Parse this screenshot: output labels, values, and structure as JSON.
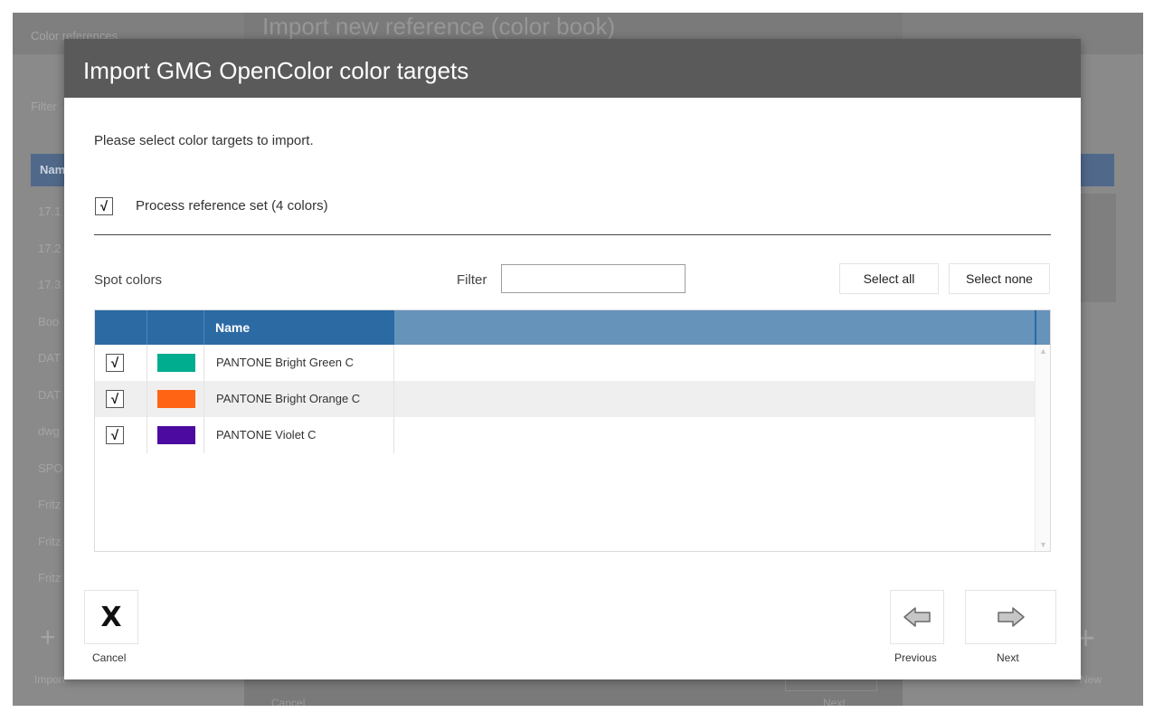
{
  "background": {
    "tab_label": "Color references",
    "filter_label": "Filter",
    "header_label": "Name",
    "rows": [
      "17.1",
      "17.2",
      "17.3",
      "Boo",
      "DAT",
      "DAT",
      "dwg",
      "SPO",
      "Fritz",
      "Fritz",
      "Fritz"
    ],
    "import_label": "Import",
    "new_label": "New",
    "mid_title": "Import new reference (color book)",
    "mid_cancel": "Cancel",
    "mid_next": "Next"
  },
  "dialog": {
    "title": "Import GMG OpenColor color targets",
    "instruction": "Please select color targets to import.",
    "process_set": {
      "label": "Process reference set (4 colors)",
      "checked": true,
      "mark": "√"
    },
    "spot_colors_label": "Spot colors",
    "filter": {
      "label": "Filter",
      "value": "",
      "placeholder": ""
    },
    "select_all_label": "Select all",
    "select_none_label": "Select none",
    "table": {
      "columns": [
        "",
        "",
        "Name"
      ],
      "rows": [
        {
          "checked": true,
          "mark": "√",
          "color": "#00ad8e",
          "name": "PANTONE Bright Green C"
        },
        {
          "checked": true,
          "mark": "√",
          "color": "#ff6414",
          "name": "PANTONE Bright Orange C"
        },
        {
          "checked": true,
          "mark": "√",
          "color": "#4c0aa0",
          "name": "PANTONE Violet C"
        }
      ]
    },
    "footer": {
      "cancel_glyph": "X",
      "cancel_label": "Cancel",
      "previous_label": "Previous",
      "next_label": "Next"
    }
  },
  "colors": {
    "header_bg": "#5a5a5a",
    "table_header": "#2b6aa3",
    "table_header_light": "#6593ba"
  },
  "icons": {
    "cancel": "close-icon",
    "previous": "arrow-left-icon",
    "next": "arrow-right-icon",
    "check": "checkmark-icon"
  }
}
